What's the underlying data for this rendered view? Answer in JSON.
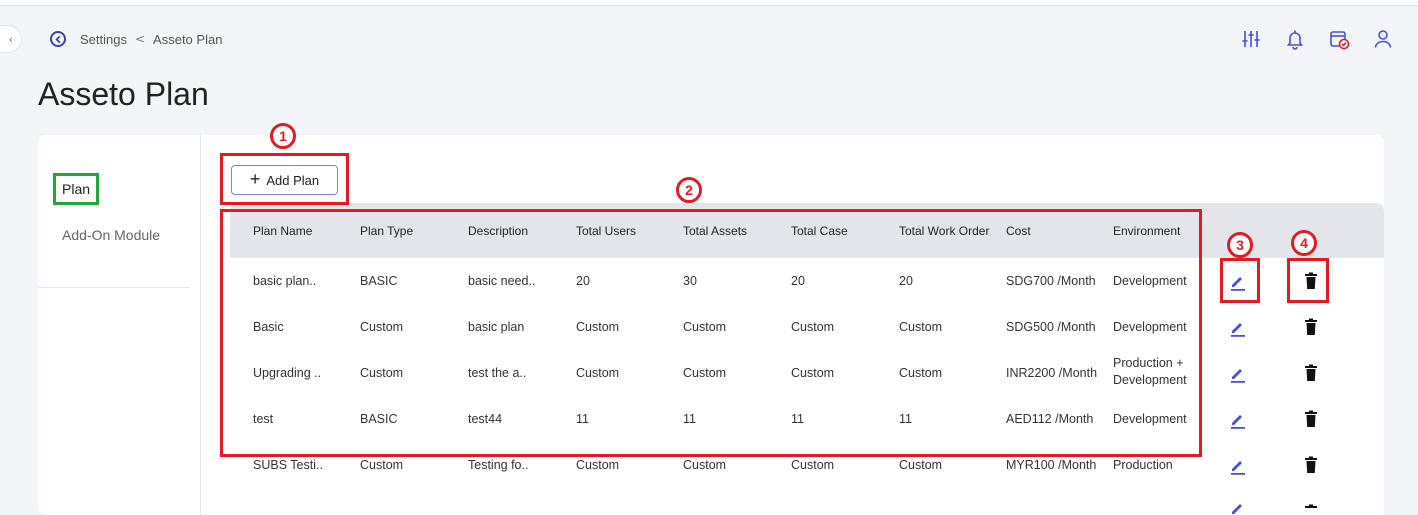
{
  "breadcrumb": {
    "parent": "Settings",
    "separator": "<",
    "current": "Asseto Plan"
  },
  "page_title": "Asseto Plan",
  "collapse_glyph": "‹",
  "top_icons": [
    "sliders-icon",
    "bell-icon",
    "calendar-check-icon",
    "user-icon"
  ],
  "sidebar": {
    "items": [
      {
        "label": "Plan",
        "active": true
      },
      {
        "label": "Add-On Module",
        "active": false
      }
    ]
  },
  "toolbar": {
    "add_plan_label": "Add Plan",
    "plus": "+"
  },
  "table": {
    "columns": [
      "Plan Name",
      "Plan Type",
      "Description",
      "Total Users",
      "Total Assets",
      "Total Case",
      "Total Work Order",
      "Cost",
      "Environment"
    ],
    "rows": [
      {
        "name": "basic plan..",
        "type": "BASIC",
        "description": "basic need..",
        "users": "20",
        "assets": "30",
        "case": "20",
        "work_order": "20",
        "cost": "SDG700 /Month",
        "environment": "Development"
      },
      {
        "name": "Basic",
        "type": "Custom",
        "description": "basic plan",
        "users": "Custom",
        "assets": "Custom",
        "case": "Custom",
        "work_order": "Custom",
        "cost": "SDG500 /Month",
        "environment": "Development"
      },
      {
        "name": "Upgrading ..",
        "type": "Custom",
        "description": "test the a..",
        "users": "Custom",
        "assets": "Custom",
        "case": "Custom",
        "work_order": "Custom",
        "cost": "INR2200 /Month",
        "environment": "Production + Development"
      },
      {
        "name": "test",
        "type": "BASIC",
        "description": "test44",
        "users": "11",
        "assets": "11",
        "case": "11",
        "work_order": "11",
        "cost": "AED112 /Month",
        "environment": "Development"
      },
      {
        "name": "SUBS Testi..",
        "type": "Custom",
        "description": "Testing fo..",
        "users": "Custom",
        "assets": "Custom",
        "case": "Custom",
        "work_order": "Custom",
        "cost": "MYR100 /Month",
        "environment": "Production"
      }
    ]
  },
  "annotations": [
    "1",
    "2",
    "3",
    "4"
  ],
  "colors": {
    "accent": "#3b3fb0",
    "edit_icon": "#4a4fd6",
    "annotation": "#e01b24",
    "active_nav_border": "#22a83a"
  }
}
